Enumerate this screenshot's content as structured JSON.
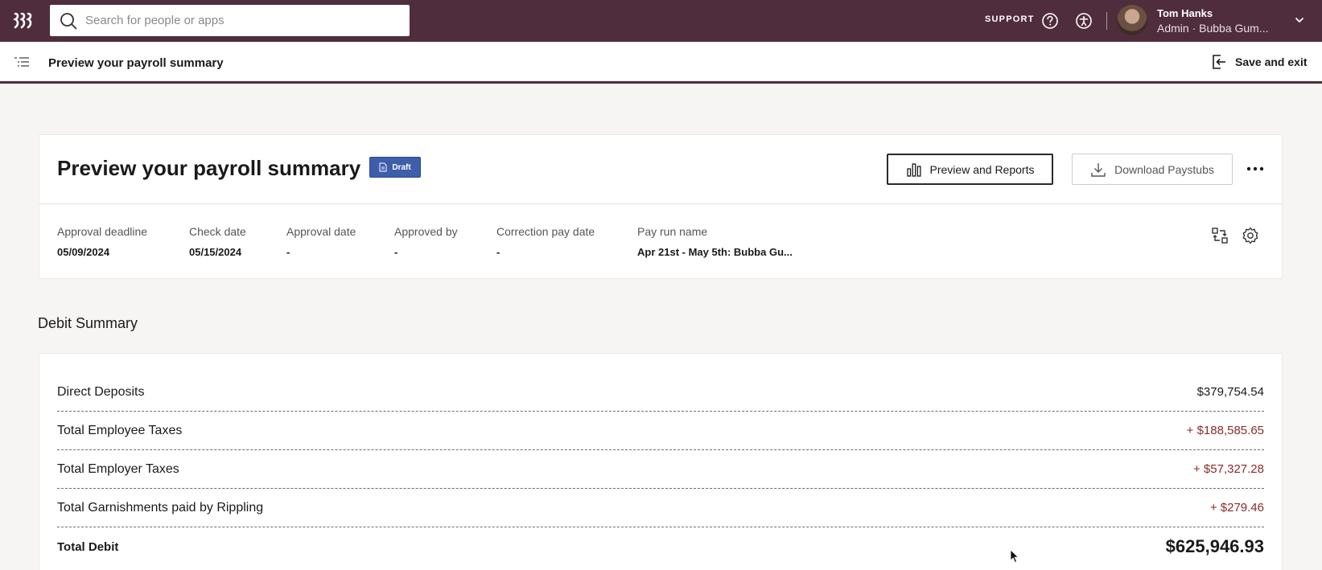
{
  "topbar": {
    "search_placeholder": "Search for people or apps",
    "support_label": "SUPPORT",
    "user_name": "Tom Hanks",
    "user_role": "Admin · Bubba Gum..."
  },
  "subbar": {
    "title": "Preview your payroll summary",
    "save_exit_label": "Save and exit"
  },
  "summary": {
    "title": "Preview your payroll summary",
    "badge": "Draft",
    "preview_reports_label": "Preview and Reports",
    "download_paystubs_label": "Download Paystubs",
    "fields": [
      {
        "label": "Approval deadline",
        "value": "05/09/2024"
      },
      {
        "label": "Check date",
        "value": "05/15/2024"
      },
      {
        "label": "Approval date",
        "value": "-"
      },
      {
        "label": "Approved by",
        "value": "-"
      },
      {
        "label": "Correction pay date",
        "value": "-"
      },
      {
        "label": "Pay run name",
        "value": "Apr 21st - May 5th: Bubba Gu..."
      }
    ]
  },
  "debit_summary": {
    "title": "Debit Summary",
    "rows": [
      {
        "label": "Direct Deposits",
        "value": "$379,754.54"
      },
      {
        "label": "Total Employee Taxes",
        "value": "+ $188,585.65"
      },
      {
        "label": "Total Employer Taxes",
        "value": "+ $57,327.28"
      },
      {
        "label": "Total Garnishments paid by Rippling",
        "value": "+ $279.46"
      }
    ],
    "total": {
      "label": "Total Debit",
      "value": "$625,946.93"
    }
  },
  "colors": {
    "brand": "#502d3c",
    "badge": "#3d5ea8",
    "addition": "#8b2a2a"
  }
}
